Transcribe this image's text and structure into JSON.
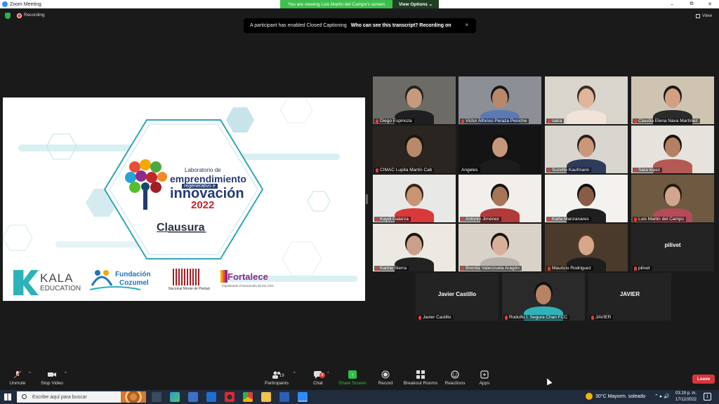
{
  "window": {
    "title": "Zoom Meeting",
    "banner": "You are viewing Luis Martin del Campo's screen",
    "view_options": "View Options ⌄",
    "minimize": "–",
    "maximize": "⧉",
    "close": "✕"
  },
  "status": {
    "recording": "Recording",
    "view": "View"
  },
  "cc_notice": {
    "text": "A participant has enabled Closed Captioning",
    "link": "Who can see this transcript? Recording on",
    "close": "×"
  },
  "slide": {
    "lab_small": "Laboratorio de",
    "lab_emp": "emprendimiento",
    "lab_reg": "regenerativo e",
    "lab_inn": "innovación",
    "lab_year": "2022",
    "clausura": "Clausura",
    "kala_1": "KALA",
    "kala_2": "EDUCATION",
    "fc_1": "Fundación",
    "fc_2": "Cozumel",
    "nm": "Nacional Monte de Piedad",
    "fo_1": "Fortalece",
    "fo_2": "Impulsando el Desarrollo de las OSC"
  },
  "participants": [
    {
      "name": "Diego Espinoza",
      "muted": true
    },
    {
      "name": "Victor Alfonso Peraza Peniche",
      "muted": true
    },
    {
      "name": "saira",
      "muted": true
    },
    {
      "name": "Claudia Elena Nava Martínez",
      "muted": true
    },
    {
      "name": "CIMAC Lupita Martín Cab",
      "muted": true
    },
    {
      "name": "Angeles",
      "muted": false
    },
    {
      "name": "Suzette Kaufmann",
      "muted": true
    },
    {
      "name": "Sara lopez",
      "muted": true
    },
    {
      "name": "Kaydi Galarza",
      "muted": true
    },
    {
      "name": "Antonio Jiménez",
      "muted": true
    },
    {
      "name": "Karla Manzanares",
      "muted": true
    },
    {
      "name": "Luis Martin del Campo",
      "muted": true
    },
    {
      "name": "Karina Sierra",
      "muted": true
    },
    {
      "name": "Brenda Valenzuela Aragón",
      "muted": true
    },
    {
      "name": "Mauricio Rodriguez",
      "muted": true
    },
    {
      "name": "pilivet",
      "muted": true,
      "big": "pilivet"
    },
    {
      "name": "Javier Castillo",
      "muted": true,
      "big": "Javier Castillo"
    },
    {
      "name": "Rodolfo I. Segura Chan FCC",
      "muted": true
    },
    {
      "name": "JAVIER",
      "muted": true,
      "big": "JAVIER"
    }
  ],
  "toolbar": {
    "unmute": "Unmute",
    "stop_video": "Stop Video",
    "participants": "Participants",
    "participant_count": "19",
    "chat": "Chat",
    "chat_badge": "8",
    "share": "Share Screen",
    "record": "Record",
    "breakout": "Breakout Rooms",
    "reactions": "Reactions",
    "apps": "Apps",
    "leave": "Leave"
  },
  "taskbar": {
    "search_placeholder": "Escribe aquí para buscar",
    "weather": "30°C  Mayorm. soleado",
    "time": "03:19 p. m.",
    "date": "17/12/2022",
    "notifications": "1"
  },
  "colors": {
    "accent_green": "#2bc04a",
    "leave_red": "#d8363a",
    "active_speaker": "#d8e23a",
    "zoom_blue": "#2d8cff"
  }
}
